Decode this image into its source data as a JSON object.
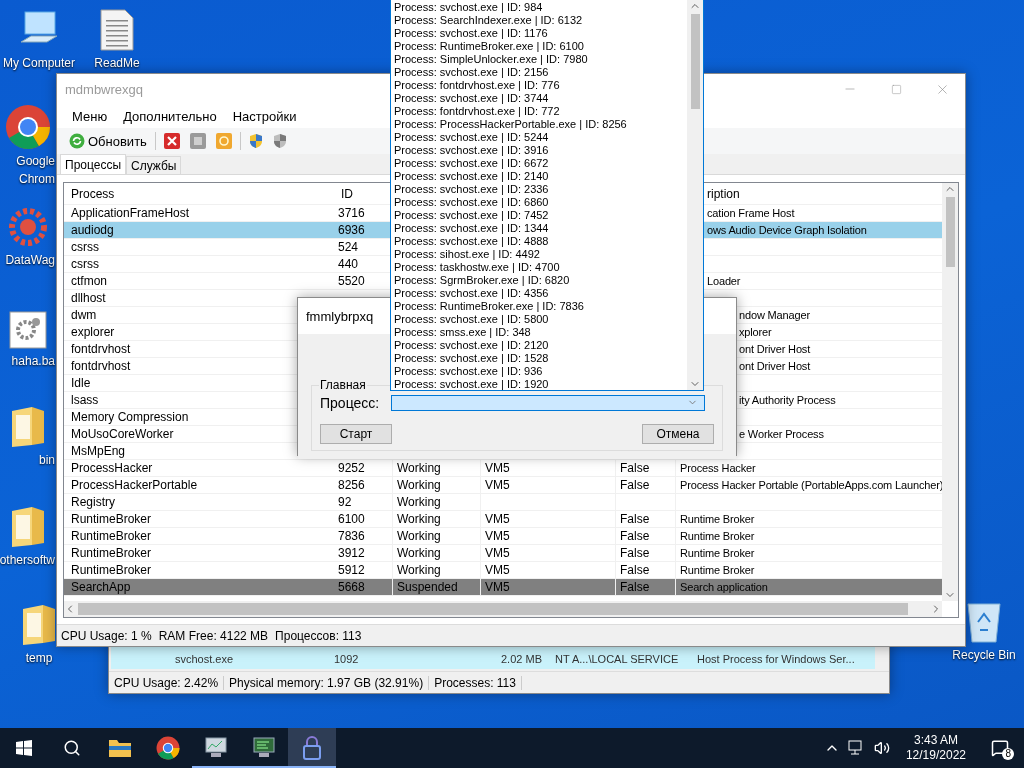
{
  "desktop_icons": [
    {
      "kind": "computer",
      "label_lines": [
        "My Computer"
      ]
    },
    {
      "kind": "document",
      "label_lines": [
        "ReadMe"
      ]
    },
    {
      "kind": "chrome",
      "label_lines": [
        "Google",
        "Chrom"
      ]
    },
    {
      "kind": "gear",
      "label_lines": [
        "DataWag"
      ]
    },
    {
      "kind": "script",
      "label_lines": [
        "haha.ba"
      ]
    },
    {
      "kind": "folder",
      "label_lines": [
        "bin"
      ]
    },
    {
      "kind": "folder",
      "label_lines": [
        "othersoftw"
      ]
    },
    {
      "kind": "folder",
      "label_lines": [
        "temp"
      ]
    },
    {
      "kind": "recycle",
      "label_lines": [
        "Recycle Bin"
      ]
    }
  ],
  "back_window": {
    "row": [
      "svchost.exe",
      "1092",
      "2.02 MB",
      "NT A...\\LOCAL SERVICE",
      "Host Process for Windows Ser..."
    ],
    "status_bar": [
      "CPU Usage: 2.42%",
      "Physical memory: 1.97 GB (32.91%)",
      "Processes: 113"
    ]
  },
  "main_window": {
    "title": "mdmbwrexgq",
    "menu": [
      "Меню",
      "Дополнительно",
      "Настройки"
    ],
    "toolbar": [
      {
        "kind": "refresh",
        "label": "Обновить"
      },
      {
        "kind": "separator"
      },
      {
        "kind": "kill"
      },
      {
        "kind": "suspend"
      },
      {
        "kind": "resume"
      },
      {
        "kind": "separator"
      },
      {
        "kind": "shield"
      },
      {
        "kind": "shield-grey"
      }
    ],
    "tabs": [
      {
        "label": "Процессы",
        "selected": true
      },
      {
        "label": "Службы",
        "selected": false
      }
    ],
    "table": {
      "headers": {
        "process": "Process",
        "id": "ID",
        "column_6": "ription"
      },
      "rows": [
        {
          "process": "ApplicationFrameHost",
          "id": "3716",
          "column_6": "cation Frame Host",
          "selected": false,
          "hot": false
        },
        {
          "process": "audiodg",
          "id": "6936",
          "column_6": "ows Audio Device Graph Isolation",
          "selected": false,
          "hot": true
        },
        {
          "process": "csrss",
          "id": "524",
          "selected": false,
          "hot": false
        },
        {
          "process": "csrss",
          "id": "440",
          "selected": false,
          "hot": false
        },
        {
          "process": "ctfmon",
          "id": "5520",
          "column_6": "Loader",
          "selected": false,
          "hot": false
        },
        {
          "process": "dllhost",
          "selected": false,
          "hot": false
        },
        {
          "process": "dwm",
          "column_6": "ndow Manager",
          "selected": false,
          "hot": false
        },
        {
          "process": "explorer",
          "column_6": "xplorer",
          "selected": false,
          "hot": false
        },
        {
          "process": "fontdrvhost",
          "column_6": "ont Driver Host",
          "selected": false,
          "hot": false
        },
        {
          "process": "fontdrvhost",
          "column_6": "ont Driver Host",
          "selected": false,
          "hot": false
        },
        {
          "process": "Idle",
          "selected": false,
          "hot": false
        },
        {
          "process": "lsass",
          "column_6": "ity Authority Process",
          "selected": false,
          "hot": false
        },
        {
          "process": "Memory Compression",
          "selected": false,
          "hot": false
        },
        {
          "process": "MoUsoCoreWorker",
          "column_6": "e Worker Process",
          "selected": false,
          "hot": false
        },
        {
          "process": "MsMpEng",
          "selected": false,
          "hot": false
        },
        {
          "process": "ProcessHacker",
          "id": "9252",
          "column_3": "Working",
          "column_4": "VM5",
          "column_5": "False",
          "column_6": "Process Hacker",
          "selected": false,
          "hot": false
        },
        {
          "process": "ProcessHackerPortable",
          "id": "8256",
          "column_3": "Working",
          "column_4": "VM5",
          "column_5": "False",
          "column_6": "Process Hacker Portable (PortableApps.com Launcher)",
          "selected": false,
          "hot": false
        },
        {
          "process": "Registry",
          "id": "92",
          "column_3": "Working",
          "selected": false,
          "hot": false
        },
        {
          "process": "RuntimeBroker",
          "id": "6100",
          "column_3": "Working",
          "column_4": "VM5",
          "column_5": "False",
          "column_6": "Runtime Broker",
          "selected": false,
          "hot": false
        },
        {
          "process": "RuntimeBroker",
          "id": "7836",
          "column_3": "Working",
          "column_4": "VM5",
          "column_5": "False",
          "column_6": "Runtime Broker",
          "selected": false,
          "hot": false
        },
        {
          "process": "RuntimeBroker",
          "id": "3912",
          "column_3": "Working",
          "column_4": "VM5",
          "column_5": "False",
          "column_6": "Runtime Broker",
          "selected": false,
          "hot": false
        },
        {
          "process": "RuntimeBroker",
          "id": "5912",
          "column_3": "Working",
          "column_4": "VM5",
          "column_5": "False",
          "column_6": "Runtime Broker",
          "selected": false,
          "hot": false
        },
        {
          "process": "SearchApp",
          "id": "5668",
          "column_3": "Suspended",
          "column_4": "VM5",
          "column_5": "False",
          "column_6": "Search application",
          "selected": true,
          "hot": false
        }
      ]
    },
    "status_bar": [
      "CPU Usage: 1 %",
      "RAM Free: 4122 MB",
      "Процессов: 113"
    ]
  },
  "dialog": {
    "title": "fmmlybrpxq",
    "group": "Главная",
    "label": "Процесс:",
    "buttons": [
      "Старт",
      "Отмена"
    ],
    "dropdown": {
      "expanded": true,
      "items": [
        "Process: svchost.exe | ID: 984",
        "Process: SearchIndexer.exe | ID: 6132",
        "Process: svchost.exe | ID: 1176",
        "Process: RuntimeBroker.exe | ID: 6100",
        "Process: SimpleUnlocker.exe | ID: 7980",
        "Process: svchost.exe | ID: 2156",
        "Process: fontdrvhost.exe | ID: 776",
        "Process: svchost.exe | ID: 3744",
        "Process: fontdrvhost.exe | ID: 772",
        "Process: ProcessHackerPortable.exe | ID: 8256",
        "Process: svchost.exe | ID: 5244",
        "Process: svchost.exe | ID: 3916",
        "Process: svchost.exe | ID: 6672",
        "Process: svchost.exe | ID: 2140",
        "Process: svchost.exe | ID: 2336",
        "Process: svchost.exe | ID: 6860",
        "Process: svchost.exe | ID: 7452",
        "Process: svchost.exe | ID: 1344",
        "Process: svchost.exe | ID: 4888",
        "Process: sihost.exe | ID: 4492",
        "Process: taskhostw.exe | ID: 4700",
        "Process: SgrmBroker.exe | ID: 6820",
        "Process: svchost.exe | ID: 4356",
        "Process: RuntimeBroker.exe | ID: 7836",
        "Process: svchost.exe | ID: 5800",
        "Process: smss.exe | ID: 348",
        "Process: svchost.exe | ID: 2120",
        "Process: svchost.exe | ID: 1528",
        "Process: svchost.exe | ID: 936",
        "Process: svchost.exe | ID: 1920"
      ]
    }
  },
  "taskbar": {
    "apps": [
      {
        "kind": "folder",
        "running": false,
        "selected": false
      },
      {
        "kind": "chrome",
        "running": false,
        "selected": false
      },
      {
        "kind": "monitor",
        "running": true,
        "selected": false
      },
      {
        "kind": "monitor-green",
        "running": true,
        "selected": false
      },
      {
        "kind": "lock",
        "running": true,
        "selected": true
      }
    ],
    "time": "3:43 AM",
    "date": "12/19/2022",
    "notifications": "8"
  }
}
